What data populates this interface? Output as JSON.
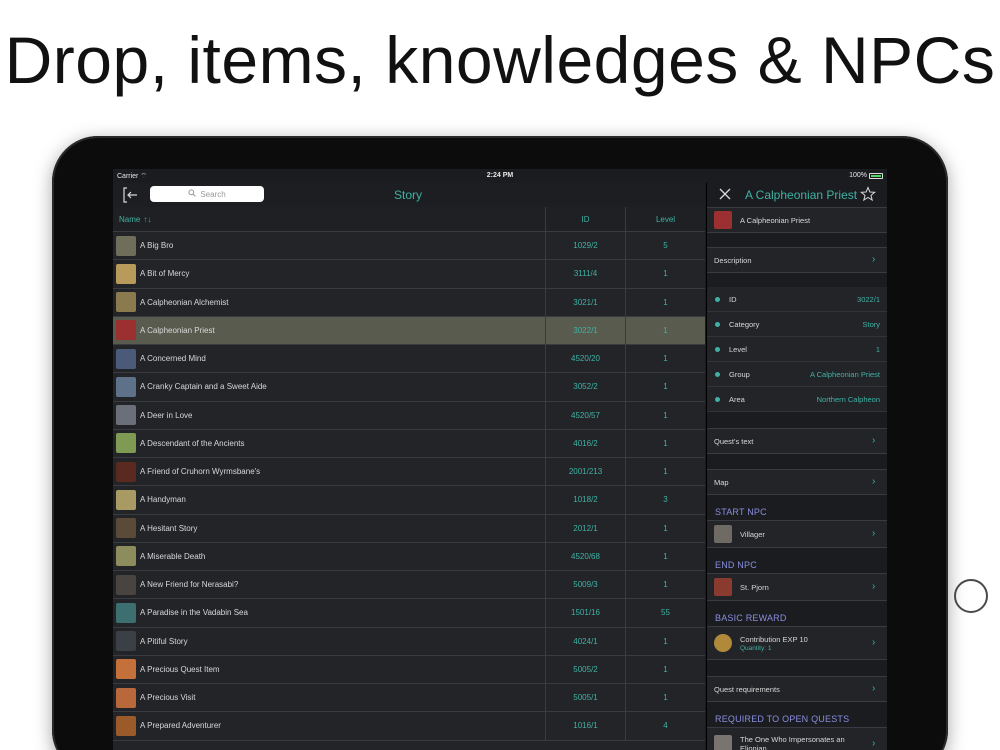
{
  "headline": "Drop, items, knowledges & NPCs",
  "status": {
    "carrier": "Carrier",
    "time": "2:24 PM",
    "battery": "100%"
  },
  "list": {
    "title": "Story",
    "search_placeholder": "Search",
    "columns": {
      "name": "Name",
      "id": "ID",
      "level": "Level"
    },
    "rows": [
      {
        "name": "A Big Bro",
        "id": "1029/2",
        "level": "5",
        "color": "#6e6e5a"
      },
      {
        "name": "A Bit of Mercy",
        "id": "3111/4",
        "level": "1",
        "color": "#b89a5a"
      },
      {
        "name": "A Calpheonian Alchemist",
        "id": "3021/1",
        "level": "1",
        "color": "#8a7a4e"
      },
      {
        "name": "A Calpheonian Priest",
        "id": "3022/1",
        "level": "1",
        "color": "#9c2f2f"
      },
      {
        "name": "A Concerned Mind",
        "id": "4520/20",
        "level": "1",
        "color": "#4a5a78"
      },
      {
        "name": "A Cranky Captain and a Sweet Aide",
        "id": "3052/2",
        "level": "1",
        "color": "#5d7288"
      },
      {
        "name": "A Deer in Love",
        "id": "4520/57",
        "level": "1",
        "color": "#6a6f7a"
      },
      {
        "name": "A Descendant of the Ancients",
        "id": "4016/2",
        "level": "1",
        "color": "#7f9a52"
      },
      {
        "name": "A Friend of Cruhorn Wyrmsbane's",
        "id": "2001/213",
        "level": "1",
        "color": "#5a2a20"
      },
      {
        "name": "A Handyman",
        "id": "1018/2",
        "level": "3",
        "color": "#a89a62"
      },
      {
        "name": "A Hesitant Story",
        "id": "2012/1",
        "level": "1",
        "color": "#5c4a38"
      },
      {
        "name": "A Miserable Death",
        "id": "4520/68",
        "level": "1",
        "color": "#8c8c5c"
      },
      {
        "name": "A New Friend for Nerasabi?",
        "id": "5009/3",
        "level": "1",
        "color": "#4a4440"
      },
      {
        "name": "A Paradise in the Vadabin Sea",
        "id": "1501/16",
        "level": "55",
        "color": "#3e6f70"
      },
      {
        "name": "A Pitiful Story",
        "id": "4024/1",
        "level": "1",
        "color": "#3b3f46"
      },
      {
        "name": "A Precious Quest Item",
        "id": "5005/2",
        "level": "1",
        "color": "#c4703a"
      },
      {
        "name": "A Precious Visit",
        "id": "5005/1",
        "level": "1",
        "color": "#b8683a"
      },
      {
        "name": "A Prepared Adventurer",
        "id": "1016/1",
        "level": "4",
        "color": "#9a5a2a"
      }
    ],
    "selected_index": 3
  },
  "detail": {
    "title": "A Calpheonian Priest",
    "header_name": "A Calpheonian Priest",
    "description_label": "Description",
    "fields": [
      {
        "key": "ID",
        "value": "3022/1"
      },
      {
        "key": "Category",
        "value": "Story"
      },
      {
        "key": "Level",
        "value": "1"
      },
      {
        "key": "Group",
        "value": "A Calpheonian Priest"
      },
      {
        "key": "Area",
        "value": "Northern Calpheon"
      }
    ],
    "quest_text_label": "Quest's text",
    "map_label": "Map",
    "start_npc_header": "START NPC",
    "start_npc": "Villager",
    "end_npc_header": "END NPC",
    "end_npc": "St. Pjorn",
    "basic_reward_header": "BASIC REWARD",
    "reward_name": "Contribution EXP 10",
    "reward_quantity": "Quantity: 1",
    "requirements_label": "Quest requirements",
    "required_header": "REQUIRED TO OPEN QUESTS",
    "required_quest": "The One Who Impersonates an Elionian"
  },
  "colors": {
    "accent": "#3fb2a5",
    "section_header": "#8a8ee0",
    "selected_row": "#5a5b4f"
  }
}
